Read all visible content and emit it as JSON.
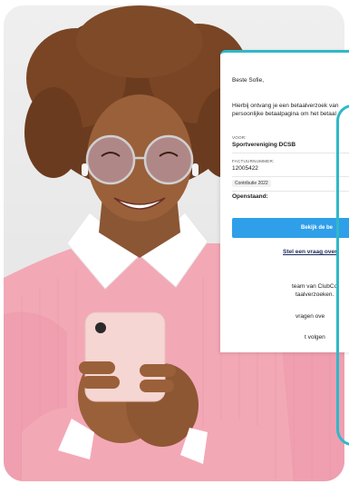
{
  "email": {
    "greeting": "Beste Sofie,",
    "intro_line1": "Hierbij ontvang je een betaalverzoek van",
    "intro_line2": "persoonlijke betaalpagina om het betaal",
    "voor_label": "VOOR:",
    "voor_value": "Sportvereniging DCSB",
    "factuur_label": "FACTUURNUMMER:",
    "factuur_value": "12005422",
    "item_tag": "Contributie 2022",
    "openstaand_label": "Openstaand:",
    "button_label": "Bekijk de be",
    "question_link": "Stel een vraag over",
    "body_line1": "team van ClubCo",
    "body_line2": "taalverzoeken.",
    "body_line3": "vragen ove",
    "body_line4": "t volgen"
  },
  "colors": {
    "accent": "#2fb8c8",
    "button": "#2f9fe9",
    "sweater": "#f3a8b6"
  }
}
